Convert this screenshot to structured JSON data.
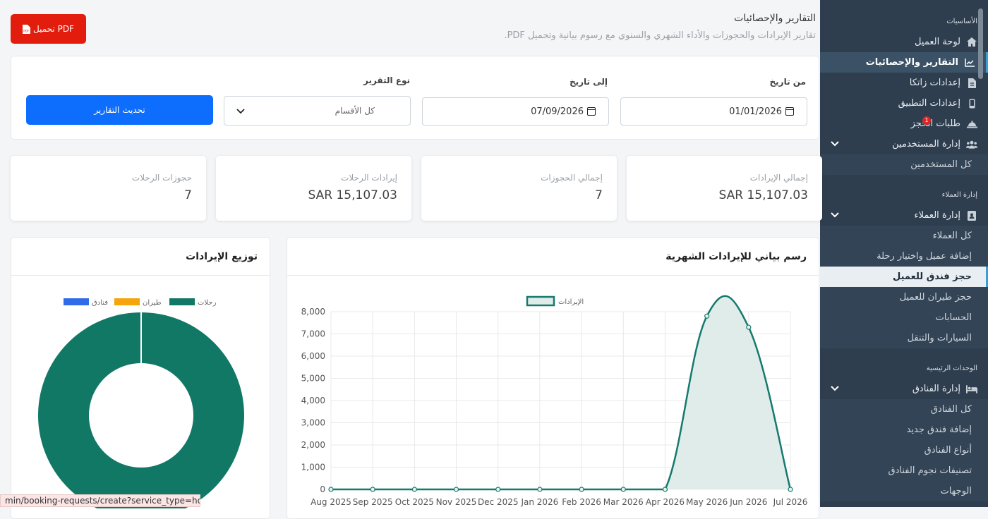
{
  "header": {
    "title": "التقارير والإحصائيات",
    "subtitle": "تقارير الإيرادات والحجوزات والأداء الشهري والسنوي مع رسوم بيانية وتحميل PDF.",
    "pdf_label": "تحميل PDF"
  },
  "filters": {
    "from_label": "من تاريخ",
    "from_value": "01/01/2026",
    "to_label": "إلى تاريخ",
    "to_value": "07/09/2026",
    "type_label": "نوع التقرير",
    "type_value": "كل الأقسام",
    "update_label": "تحديث التقارير"
  },
  "stats": [
    {
      "label": "إجمالي الإيرادات",
      "value": "SAR 15,107.03"
    },
    {
      "label": "إجمالي الحجوزات",
      "value": "7"
    },
    {
      "label": "إيرادات الرحلات",
      "value": "SAR 15,107.03"
    },
    {
      "label": "حجوزات الرحلات",
      "value": "7"
    }
  ],
  "line_card_title": "رسم بياني للإيرادات الشهرية",
  "donut_card_title": "توزيع الإيرادات",
  "colors": {
    "line": "#157a6e",
    "fill": "#e0ece9",
    "trips": "#127866",
    "flights": "#f5a40c",
    "hotels": "#2f6be8",
    "sidebar": "#2e3e4f",
    "accent": "#0d6efd",
    "pdf": "#e21d0d"
  },
  "chart_data": [
    {
      "type": "line",
      "title": "",
      "x": [
        "Aug 2025",
        "Sep 2025",
        "Oct 2025",
        "Nov 2025",
        "Dec 2025",
        "Jan 2026",
        "Feb 2026",
        "Mar 2026",
        "Apr 2026",
        "May 2026",
        "Jun 2026",
        "Jul 2026"
      ],
      "series": [
        {
          "name": "الإيرادات",
          "values": [
            0,
            0,
            0,
            0,
            0,
            0,
            0,
            0,
            0,
            7800,
            7300,
            0
          ]
        }
      ],
      "ylim": [
        0,
        8000
      ],
      "yticks": [
        "0",
        "1,000",
        "2,000",
        "3,000",
        "4,000",
        "5,000",
        "6,000",
        "7,000",
        "8,000"
      ],
      "grid": true,
      "legend": "top"
    },
    {
      "type": "pie",
      "title": "",
      "categories": [
        "رحلات",
        "طيران",
        "فنادق"
      ],
      "values": [
        15107.03,
        0,
        0
      ],
      "legend": "top"
    }
  ],
  "sidebar": {
    "sec_basics": "الأساسيات",
    "dashboard": "لوحة العميل",
    "reports": "التقارير والإحصائيات",
    "zatca": "إعدادات زاتكا",
    "app_settings": "إعدادات التطبيق",
    "booking_requests": "طلبات الحجز",
    "booking_badge": "1",
    "users_mgmt": "إدارة المستخدمين",
    "all_users": "كل المستخدمين",
    "sec_clients": "إدارة العملاء",
    "clients_mgmt": "إدارة العملاء",
    "all_clients": "كل العملاء",
    "add_client_trip": "إضافة عميل واختيار رحلة",
    "book_hotel": "حجز فندق للعميل",
    "book_flight": "حجز طيران للعميل",
    "accounts": "الحسابات",
    "cars": "السيارات والتنقل",
    "sec_main_units": "الوحدات الرئيسية",
    "hotels_mgmt": "إدارة الفنادق",
    "all_hotels": "كل الفنادق",
    "add_hotel": "إضافة فندق جديد",
    "hotel_types": "أنواع الفنادق",
    "hotel_stars": "تصنيفات نجوم الفنادق",
    "destinations": "الوجهات"
  },
  "status_url": "min/booking-requests/create?service_type=hotel"
}
